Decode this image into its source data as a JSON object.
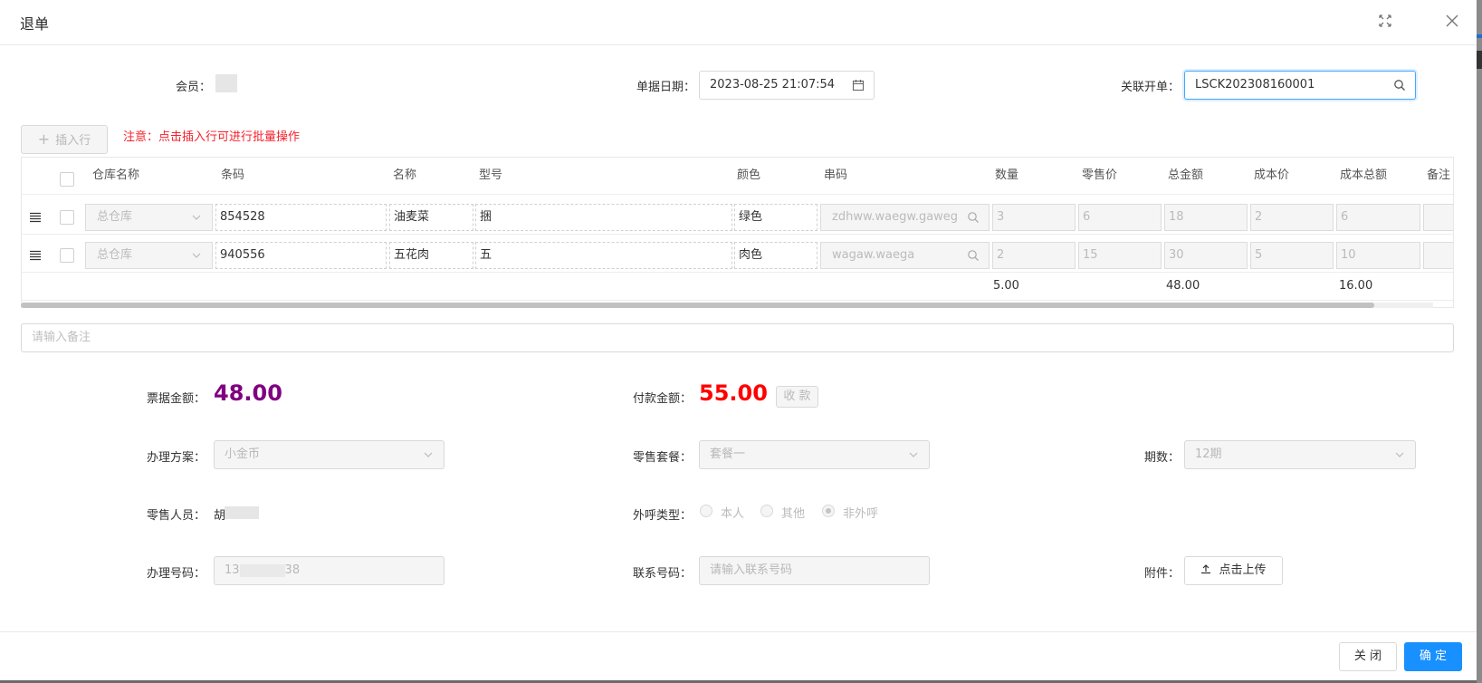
{
  "dialog": {
    "title": "退单"
  },
  "form": {
    "member_label": "会员：",
    "date_label": "单据日期：",
    "date_value": "2023-08-25 21:07:54",
    "related_label": "关联开单：",
    "related_value": "LSCK202308160001"
  },
  "toolbar": {
    "insert_row": "插入行",
    "notice": "注意：点击插入行可进行批量操作"
  },
  "table": {
    "columns": [
      "仓库名称",
      "条码",
      "名称",
      "型号",
      "颜色",
      "串码",
      "数量",
      "零售价",
      "总金额",
      "成本价",
      "成本总额",
      "备注"
    ],
    "rows": [
      {
        "warehouse": "总仓库",
        "barcode": "854528",
        "name": "油麦菜",
        "model": "捆",
        "color": "绿色",
        "serial": "zdhww.waegw.gaweg",
        "qty": "3",
        "price": "6",
        "total": "18",
        "cost": "2",
        "cost_total": "6"
      },
      {
        "warehouse": "总仓库",
        "barcode": "940556",
        "name": "五花肉",
        "model": "五",
        "color": "肉色",
        "serial": "wagaw.waega",
        "qty": "2",
        "price": "15",
        "total": "30",
        "cost": "5",
        "cost_total": "10"
      }
    ],
    "totals": {
      "qty": "5.00",
      "total": "48.00",
      "cost_total": "16.00"
    }
  },
  "remark": {
    "placeholder": "请输入备注"
  },
  "amounts": {
    "bill_label": "票据金额：",
    "bill_value": "48.00",
    "pay_label": "付款金额：",
    "pay_value": "55.00",
    "collect_button": "收 款"
  },
  "plan": {
    "plan_label": "办理方案：",
    "plan_value": "小金币",
    "package_label": "零售套餐：",
    "package_value": "套餐一",
    "period_label": "期数：",
    "period_value": "12期"
  },
  "staff": {
    "label": "零售人员：",
    "value_prefix": "胡",
    "call_label": "外呼类型：",
    "call_options": [
      "本人",
      "其他",
      "非外呼"
    ],
    "call_selected": "非外呼"
  },
  "numbers": {
    "handle_label": "办理号码：",
    "handle_prefix": "13",
    "handle_suffix": "38",
    "contact_label": "联系号码：",
    "contact_placeholder": "请输入联系号码",
    "attach_label": "附件：",
    "upload_button": "点击上传"
  },
  "footer": {
    "close": "关 闭",
    "confirm": "确 定"
  },
  "colors": {
    "primary": "#1890ff",
    "bill_amount": "#800080",
    "pay_amount": "#ff0000",
    "notice": "#f5222d"
  }
}
